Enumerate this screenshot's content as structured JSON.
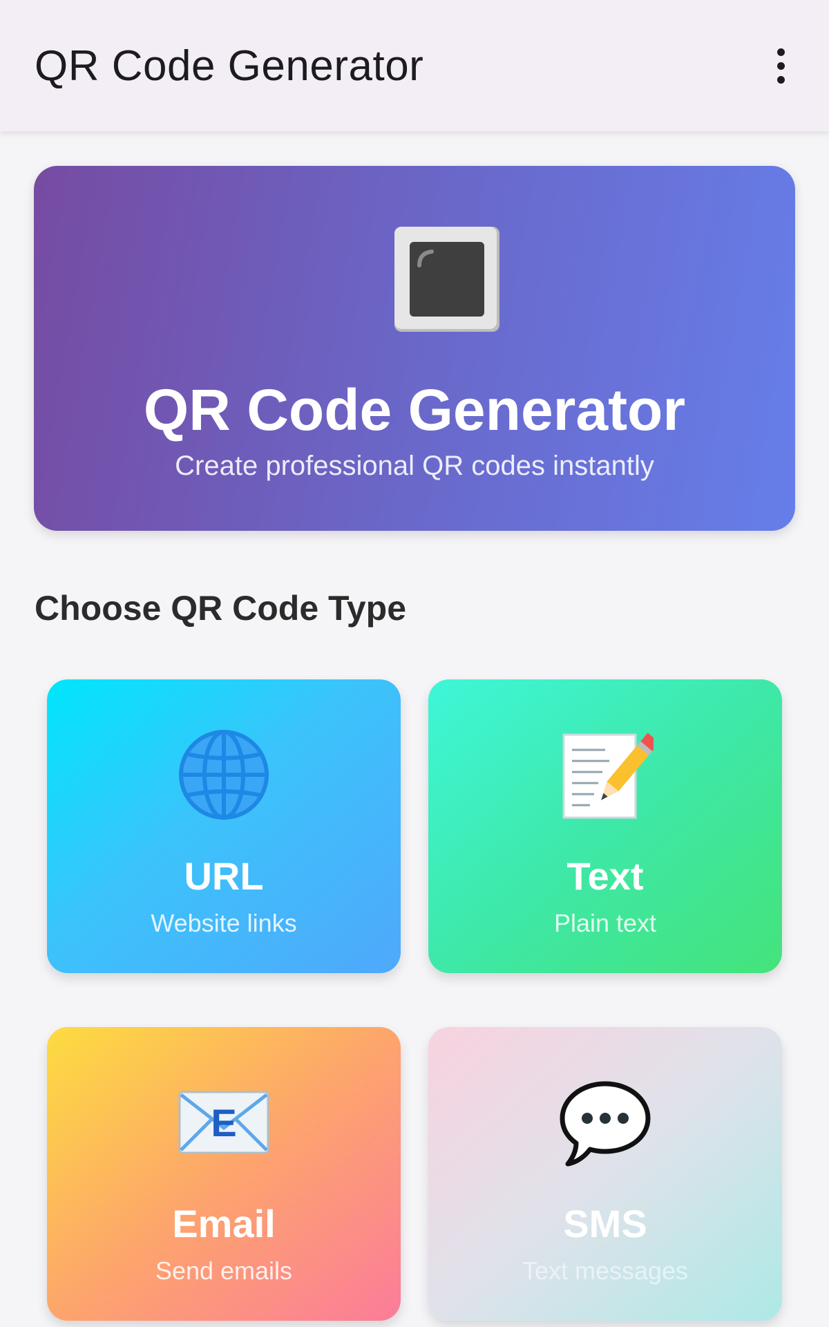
{
  "appbar": {
    "title": "QR Code Generator",
    "menu_icon": "more-vert-icon"
  },
  "hero": {
    "icon": "black-square-button-icon",
    "title": "QR Code Generator",
    "subtitle": "Create professional QR codes instantly",
    "gradient": [
      "#764ba2",
      "#667eea"
    ]
  },
  "section": {
    "title": "Choose QR Code Type"
  },
  "types": [
    {
      "label": "URL",
      "description": "Website links",
      "icon": "globe-icon",
      "gradient": [
        "#00e6fb",
        "#4fa8fb"
      ]
    },
    {
      "label": "Text",
      "description": "Plain text",
      "icon": "memo-pencil-icon",
      "gradient": [
        "#3ef6d8",
        "#44e37a"
      ]
    },
    {
      "label": "Email",
      "description": "Send emails",
      "icon": "email-icon",
      "gradient": [
        "#fddc3f",
        "#fb7c9a"
      ]
    },
    {
      "label": "SMS",
      "description": "Text messages",
      "icon": "speech-bubble-icon",
      "gradient": [
        "#f8d2df",
        "#ade9e6"
      ]
    }
  ]
}
